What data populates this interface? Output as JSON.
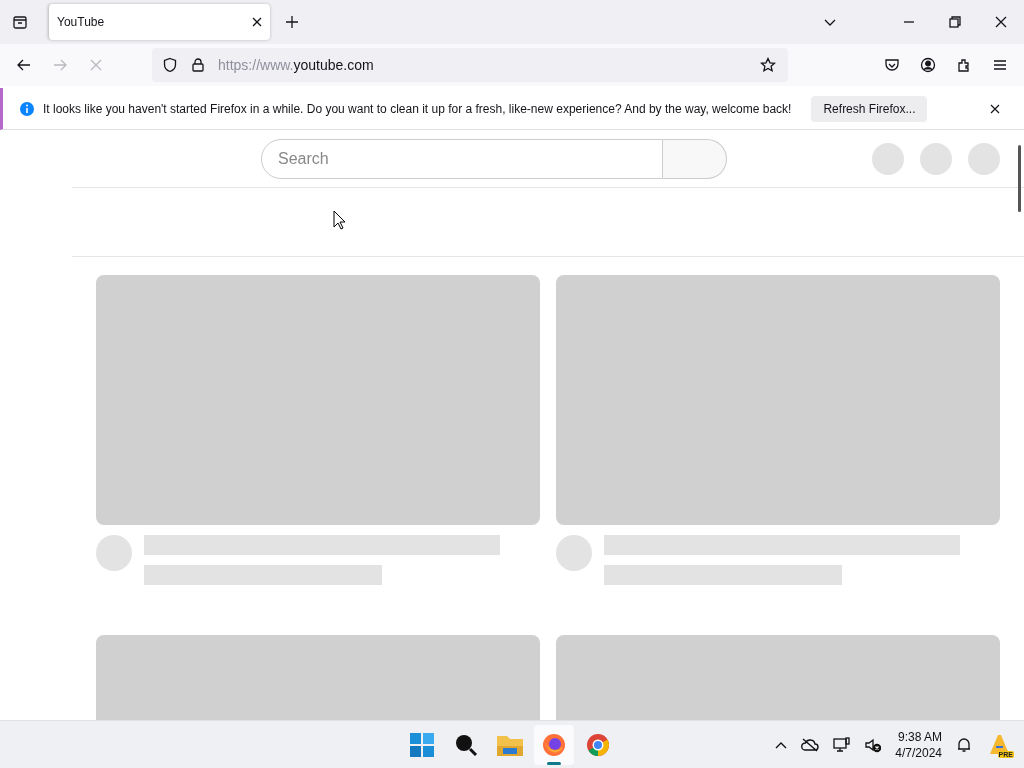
{
  "tabs": [
    {
      "title": "YouTube",
      "selected": true
    }
  ],
  "navigation": {
    "back_disabled": false,
    "forward_disabled": true,
    "loading": true,
    "url_prefix": "https://www.",
    "url_domain": "youtube.com"
  },
  "notification": {
    "message": "It looks like you haven't started Firefox in a while. Do you want to clean it up for a fresh, like-new experience? And by the way, welcome back!",
    "button": "Refresh Firefox..."
  },
  "page": {
    "search": {
      "placeholder": "Search"
    },
    "cards": [
      {
        "kind": "loading"
      },
      {
        "kind": "loading"
      },
      {
        "kind": "thumbnail_only"
      },
      {
        "kind": "thumbnail_only"
      }
    ]
  },
  "taskbar": {
    "apps": [
      {
        "kind": "start",
        "selected": false
      },
      {
        "kind": "search",
        "selected": false
      },
      {
        "kind": "files",
        "selected": false
      },
      {
        "kind": "firefox",
        "selected": true
      },
      {
        "kind": "chrome",
        "selected": false
      }
    ],
    "time": "9:38 AM",
    "date": "4/7/2024",
    "badge": "PRE"
  }
}
